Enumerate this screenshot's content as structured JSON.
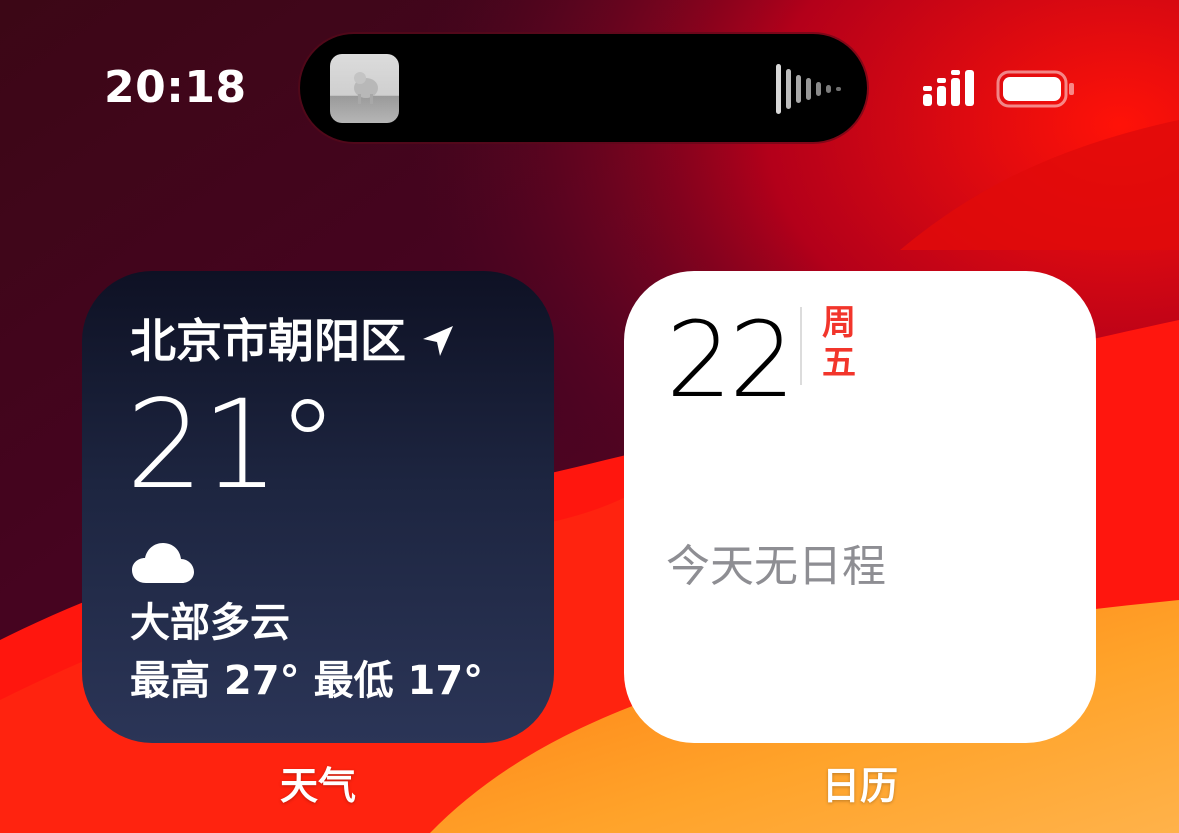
{
  "status_bar": {
    "time": "20:18",
    "now_playing_icon": "album-art",
    "waveform_icon": "audio-waveform-icon",
    "signal_icon": "cellular-signal-icon",
    "battery_icon": "battery-icon"
  },
  "widgets": {
    "weather": {
      "location": "北京市朝阳区",
      "location_icon": "location-arrow-icon",
      "temperature": "21°",
      "condition_icon": "cloud-icon",
      "condition": "大部多云",
      "high": "最高 27°",
      "low": "最低 17°",
      "label": "天气"
    },
    "calendar": {
      "day": "22",
      "weekday": "周五",
      "weekday_color": "#f2352b",
      "empty_text": "今天无日程",
      "label": "日历"
    }
  },
  "colors": {
    "wallpaper_dark": "#4a0a1c",
    "wallpaper_red": "#ff1a14",
    "wallpaper_orange": "#ff9a1e"
  }
}
